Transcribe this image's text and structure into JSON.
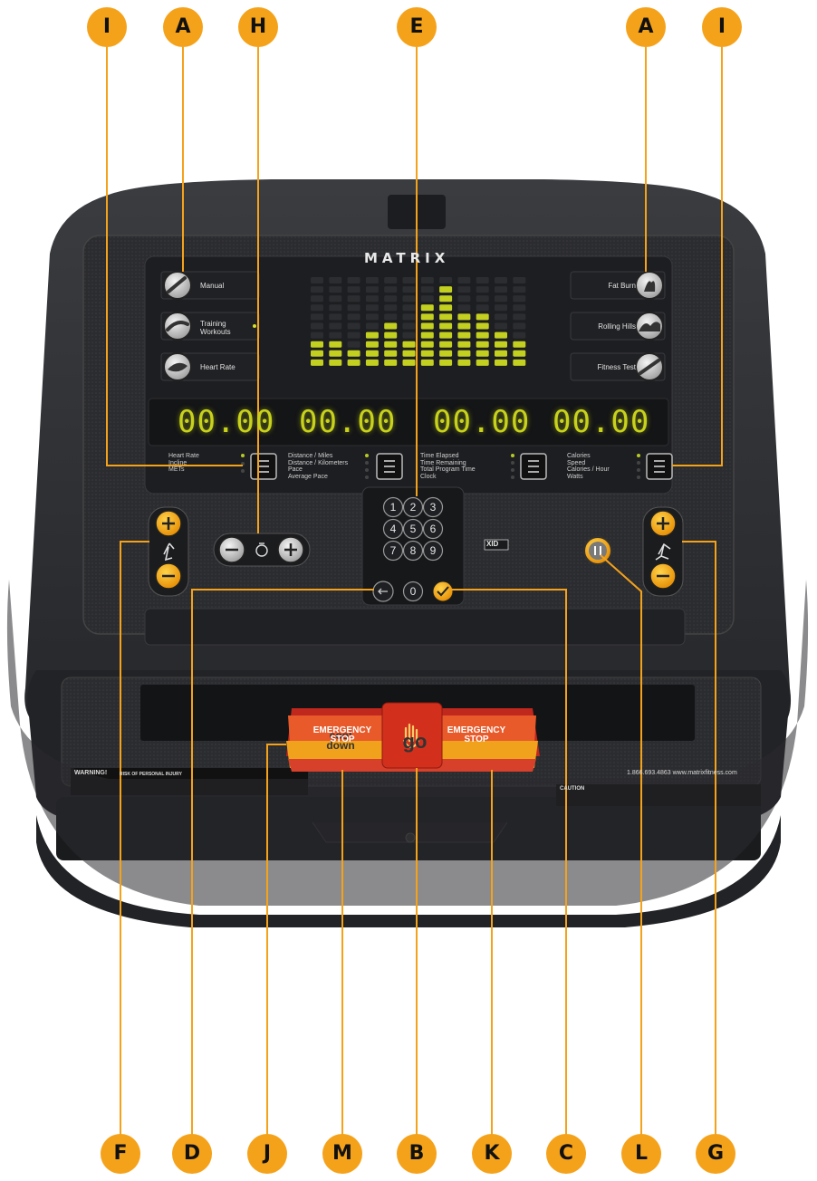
{
  "callouts_top": [
    "I",
    "A",
    "H",
    "E",
    "A",
    "I"
  ],
  "callouts_bottom": [
    "F",
    "D",
    "J",
    "M",
    "B",
    "K",
    "C",
    "L",
    "G"
  ],
  "brand": "MATRIX",
  "programs_left": [
    "Manual",
    "Training Workouts",
    "Heart Rate"
  ],
  "programs_right": [
    "Fat Burn",
    "Rolling Hills",
    "Fitness Test"
  ],
  "displays": [
    "00.00",
    "00.00",
    "00.00",
    "00.00"
  ],
  "metric_groups": [
    [
      "Heart Rate",
      "Incline",
      "METs"
    ],
    [
      "Distance / Miles",
      "Distance / Kilometers",
      "Pace",
      "Average Pace"
    ],
    [
      "Time Elapsed",
      "Time Remaining",
      "Total Program Time",
      "Clock"
    ],
    [
      "Calories",
      "Speed",
      "Calories / Hour",
      "Watts"
    ]
  ],
  "keypad": [
    "1",
    "2",
    "3",
    "4",
    "5",
    "6",
    "7",
    "8",
    "9",
    "0"
  ],
  "xid_label": "XID",
  "buttons": {
    "cool_down": "cool down",
    "go": "go"
  },
  "emergency_stop": "EMERGENCY STOP",
  "phone": "1.866.693.4863  www.matrixfitness.com",
  "warning_title": "WARNING!",
  "warning_subtitle": "RISK OF PERSONAL INJURY",
  "caution_title": "CAUTION",
  "colors": {
    "callout": "#f5a21b",
    "led": "#c8d21a",
    "go": "#2a9a3a",
    "stop": "#d9373f",
    "cool": "#3a8ee0"
  }
}
